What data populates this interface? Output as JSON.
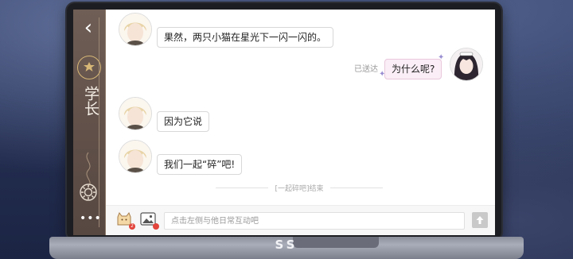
{
  "contact": {
    "name": "学长"
  },
  "messages": [
    {
      "from": "contact",
      "text": "果然，两只小猫在星光下一闪一闪的。"
    },
    {
      "from": "me",
      "text": "为什么呢?",
      "status": "已送达"
    },
    {
      "from": "contact",
      "text": "因为它说"
    },
    {
      "from": "contact",
      "text": "我们一起“碎”吧!"
    }
  ],
  "chat_end_notice": "[一起碎吧]结束",
  "input": {
    "placeholder": "点击左侧与他日常互动吧"
  },
  "device_brand": "SS",
  "badges": {
    "gift_count": "2"
  },
  "icons": {
    "back": "back-chevron-icon",
    "emblem": "crest-emblem-icon",
    "settings": "gear-icon",
    "more": "more-dots-icon",
    "gift": "gift-cat-icon",
    "image": "image-icon",
    "send": "send-arrow-icon"
  },
  "colors": {
    "sidebar": "#6f5e55",
    "accent_gold": "#d7b777",
    "my_bubble": "#fbeef6",
    "badge_red": "#e2443b"
  }
}
